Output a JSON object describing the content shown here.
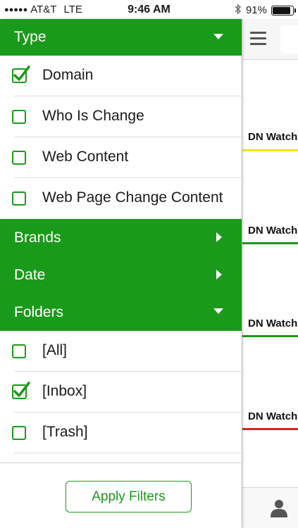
{
  "status_bar": {
    "signal": "●●●●●",
    "carrier": "AT&T",
    "network": "LTE",
    "time": "9:46 AM",
    "bluetooth_icon": "bluetooth-icon",
    "battery_percent": "91%",
    "battery_level": 0.91
  },
  "filters": {
    "type": {
      "label": "Type",
      "expanded": true,
      "items": [
        {
          "label": "Domain",
          "checked": true
        },
        {
          "label": "Who Is Change",
          "checked": false
        },
        {
          "label": "Web Content",
          "checked": false
        },
        {
          "label": "Web Page Change Content",
          "checked": false
        }
      ]
    },
    "brands": {
      "label": "Brands",
      "expanded": false
    },
    "date": {
      "label": "Date",
      "expanded": false
    },
    "folders": {
      "label": "Folders",
      "expanded": true,
      "items": [
        {
          "label": "[All]",
          "checked": false
        },
        {
          "label": "[Inbox]",
          "checked": true
        },
        {
          "label": "[Trash]",
          "checked": false
        }
      ]
    }
  },
  "footer": {
    "apply_label": "Apply Filters"
  },
  "background_list": {
    "cards": [
      {
        "label": "DN Watch",
        "color": "#f2e600"
      },
      {
        "label": "DN Watch",
        "color": "#1a9a1a"
      },
      {
        "label": "DN Watch",
        "color": "#1a9a1a"
      },
      {
        "label": "DN Watch",
        "color": "#d9251d"
      }
    ]
  },
  "colors": {
    "accent": "#1a9a1a"
  }
}
